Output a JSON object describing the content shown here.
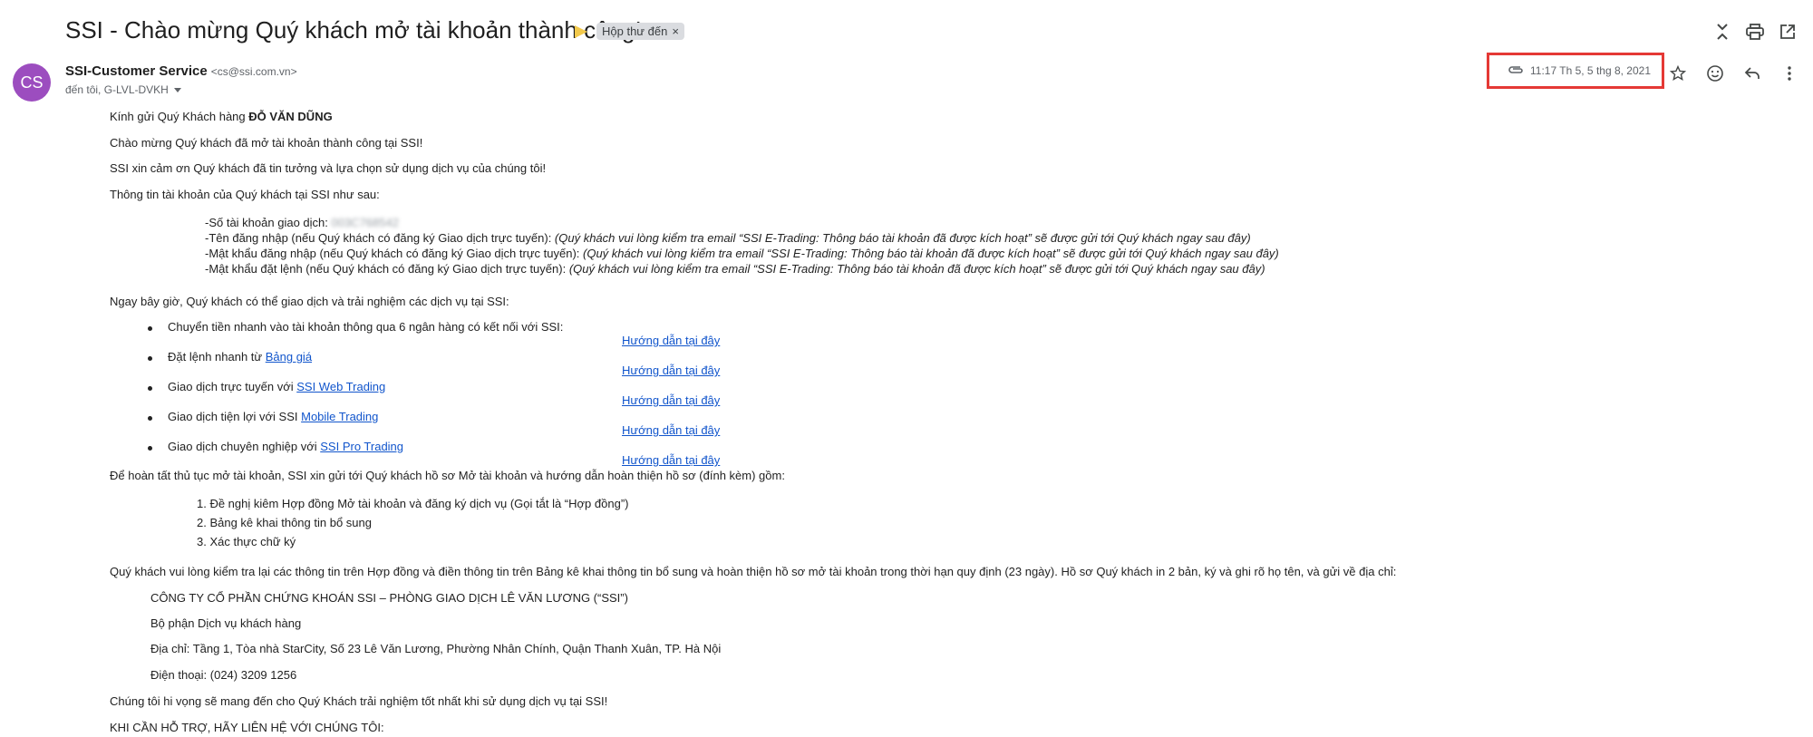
{
  "subject": "SSI - Chào mừng Quý khách mở tài khoản thành công!",
  "label": "Hộp thư đến",
  "label_close": "×",
  "avatar_initials": "CS",
  "avatar_color": "#9c4dbf",
  "sender_name": "SSI-Customer Service",
  "sender_email": "<cs@ssi.com.vn>",
  "recipients": "đến tôi, G-LVL-DVKH",
  "date": "11:17 Th 5, 5 thg 8, 2021",
  "highlight_color": "#e53935",
  "icons": {
    "collapse": "collapse-icon",
    "print": "print-icon",
    "open_new": "open-in-new-icon",
    "attachment": "attachment-icon",
    "star": "star-icon",
    "emoji": "emoji-icon",
    "reply": "reply-icon",
    "more": "more-vert-icon"
  },
  "body": {
    "greeting_prefix": "Kính gửi Quý Khách hàng ",
    "greeting_name": "ĐỖ VĂN DŨNG",
    "welcome": "Chào mừng Quý khách đã mở tài khoản thành công tại SSI!",
    "thanks": "SSI xin cảm ơn Quý khách đã tin tưởng và lựa chọn sử dụng dịch vụ của chúng tôi!",
    "info_intro": "Thông tin tài khoản của Quý khách tại SSI như sau:",
    "account_label": "-Số tài khoản giao dịch: ",
    "account_value": "003C768542",
    "login_label": "-Tên đăng nhập (nếu Quý khách có đăng ký Giao dịch trực tuyến): ",
    "login_note": "(Quý khách vui lòng kiểm tra email “SSI E-Trading: Thông báo tài khoản đã được kích hoạt” sẽ được gửi tới Quý khách ngay sau đây)",
    "password_label": "-Mật khẩu đăng nhập (nếu Quý khách có đăng ký Giao dịch trực tuyến): ",
    "password_note": "(Quý khách vui lòng kiểm tra email “SSI E-Trading: Thông báo tài khoản đã được kích hoạt” sẽ được gửi tới Quý khách ngay sau đây)",
    "order_pw_label": "-Mật khẩu đặt lệnh (nếu Quý khách có đăng ký Giao dịch trực tuyến): ",
    "order_pw_note": "(Quý khách vui lòng kiểm tra email “SSI E-Trading: Thông báo tài khoản đã được kích hoạt” sẽ được gửi tới Quý khách ngay sau đây)",
    "services_intro": "Ngay bây giờ, Quý khách có thể giao dịch và trải nghiệm các dịch vụ tại SSI:",
    "services": [
      {
        "text": "Chuyển tiền nhanh vào tài khoản thông qua 6 ngân hàng có kết nối với SSI:",
        "link": ""
      },
      {
        "text": "Đặt lệnh nhanh từ ",
        "link": "Bảng giá"
      },
      {
        "text": "Giao dịch trực tuyến với ",
        "link": "SSI Web Trading"
      },
      {
        "text": "Giao dịch tiện lợi với SSI ",
        "link": "Mobile Trading"
      },
      {
        "text": "Giao dịch chuyên nghiệp với ",
        "link": "SSI Pro Trading"
      }
    ],
    "guide_links": [
      "Hướng dẫn tại đây",
      "Hướng dẫn tại đây",
      "Hướng dẫn tại đây",
      "Hướng dẫn tại đây",
      "Hướng dẫn tại đây"
    ],
    "docs_intro": "Để hoàn tất thủ tục mở tài khoản, SSI xin gửi tới Quý khách hồ sơ Mở tài khoản và hướng dẫn hoàn thiện hồ sơ (đính kèm) gồm:",
    "docs": [
      "1. Đề nghị kiêm Hợp đồng Mở tài khoản và đăng ký dịch vụ (Gọi tắt là “Hợp đồng”)",
      "2. Bảng kê khai thông tin bổ sung",
      "3. Xác thực chữ ký"
    ],
    "check_note": "Quý khách vui lòng kiểm tra lại các thông tin trên Hợp đồng và điền thông tin trên Bảng kê khai thông tin bổ sung và hoàn thiện hồ sơ mở tài khoản trong thời hạn quy định (23 ngày). Hồ sơ Quý khách in 2 bản, ký và ghi rõ họ tên, và gửi về địa chỉ:",
    "company": "CÔNG TY CỔ PHẦN CHỨNG KHOÁN SSI – PHÒNG GIAO DỊCH LÊ VĂN LƯƠNG (“SSI”)",
    "department": "Bộ phận Dịch vụ khách hàng",
    "address": "Địa chỉ: Tầng 1, Tòa nhà StarCity, Số 23 Lê Văn Lương, Phường Nhân Chính, Quận Thanh Xuân, TP. Hà Nội",
    "phone": "Điện thoại: (024) 3209 1256",
    "closing": "Chúng tôi hi vọng sẽ mang đến cho Quý Khách trải nghiệm tốt nhất khi sử dụng dịch vụ tại SSI!",
    "support_heading": "KHI CẦN HỖ TRỢ, HÃY LIÊN HỆ VỚI CHÚNG TÔI:"
  }
}
